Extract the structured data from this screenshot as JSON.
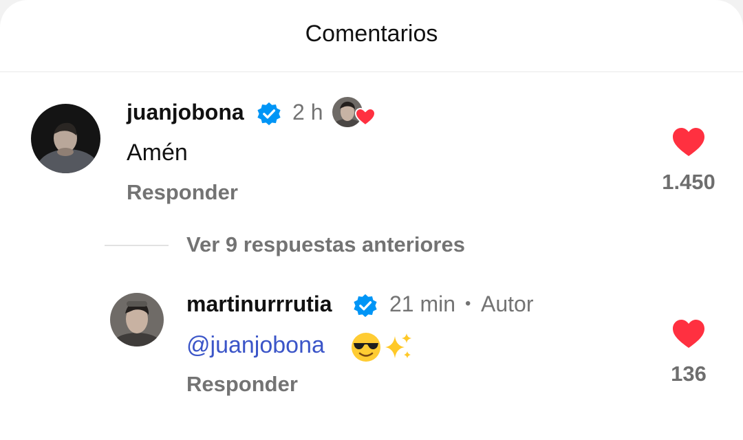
{
  "header": {
    "title": "Comentarios"
  },
  "comments": [
    {
      "username": "juanjobona",
      "verified": true,
      "time": "2 h",
      "author_liked": true,
      "text": "Amén",
      "reply_label": "Responder",
      "likes": "1.450"
    }
  ],
  "thread": {
    "view_replies_label": "Ver 9 respuestas anteriores"
  },
  "replies": [
    {
      "username": "martinurrrutia",
      "verified": true,
      "time": "21 min",
      "separator": "•",
      "badge": "Autor",
      "mention": "@juanjobona",
      "emojis": [
        "smiling-face-with-sunglasses",
        "sparkles"
      ],
      "reply_label": "Responder",
      "likes": "136"
    }
  ],
  "colors": {
    "heart": "#ff3040",
    "verified": "#0095f6",
    "mention": "#3b55c8",
    "secondary_text": "#737373"
  }
}
